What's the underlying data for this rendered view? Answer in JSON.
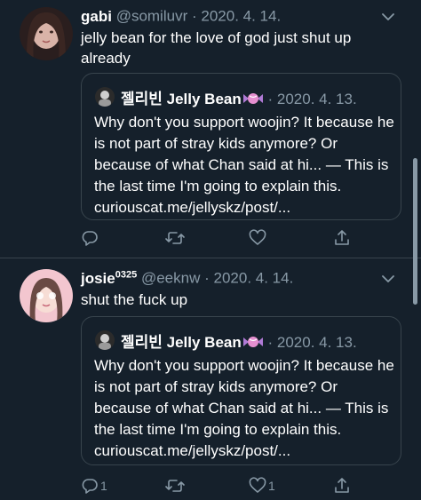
{
  "tweets": [
    {
      "name": "gabi",
      "name_sup": "",
      "handle": "@somiluvr",
      "separator": "·",
      "date": "2020. 4. 14.",
      "text": "jelly bean for the love of god just shut up already",
      "quote": {
        "name": "젤리빈 Jelly Bean",
        "separator": "·",
        "date": "2020. 4. 13.",
        "text": "Why don't you support woojin? It because he is not part of stray kids anymore? Or because of what Chan said at hi... — This is the last time I'm going to explain this. curiouscat.me/jellyskz/post/..."
      },
      "actions": {
        "reply_count": "",
        "retweet_count": "",
        "like_count": ""
      }
    },
    {
      "name": "josie",
      "name_sup": "0325",
      "handle": "@eeknw",
      "separator": "·",
      "date": "2020. 4. 14.",
      "text": "shut the fuck up",
      "quote": {
        "name": "젤리빈 Jelly Bean",
        "separator": "·",
        "date": "2020. 4. 13.",
        "text": "Why don't you support woojin? It because he is not part of stray kids anymore? Or because of what Chan said at hi... — This is the last time I'm going to explain this. curiouscat.me/jellyskz/post/..."
      },
      "actions": {
        "reply_count": "1",
        "retweet_count": "",
        "like_count": "1"
      }
    }
  ],
  "colors": {
    "background": "#15202b",
    "border": "#38444d",
    "secondary_text": "#8899a6",
    "primary_text": "#ffffff"
  },
  "icons": [
    "more-icon",
    "reply-icon",
    "retweet-icon",
    "like-icon",
    "share-icon",
    "candy-emoji-icon"
  ]
}
